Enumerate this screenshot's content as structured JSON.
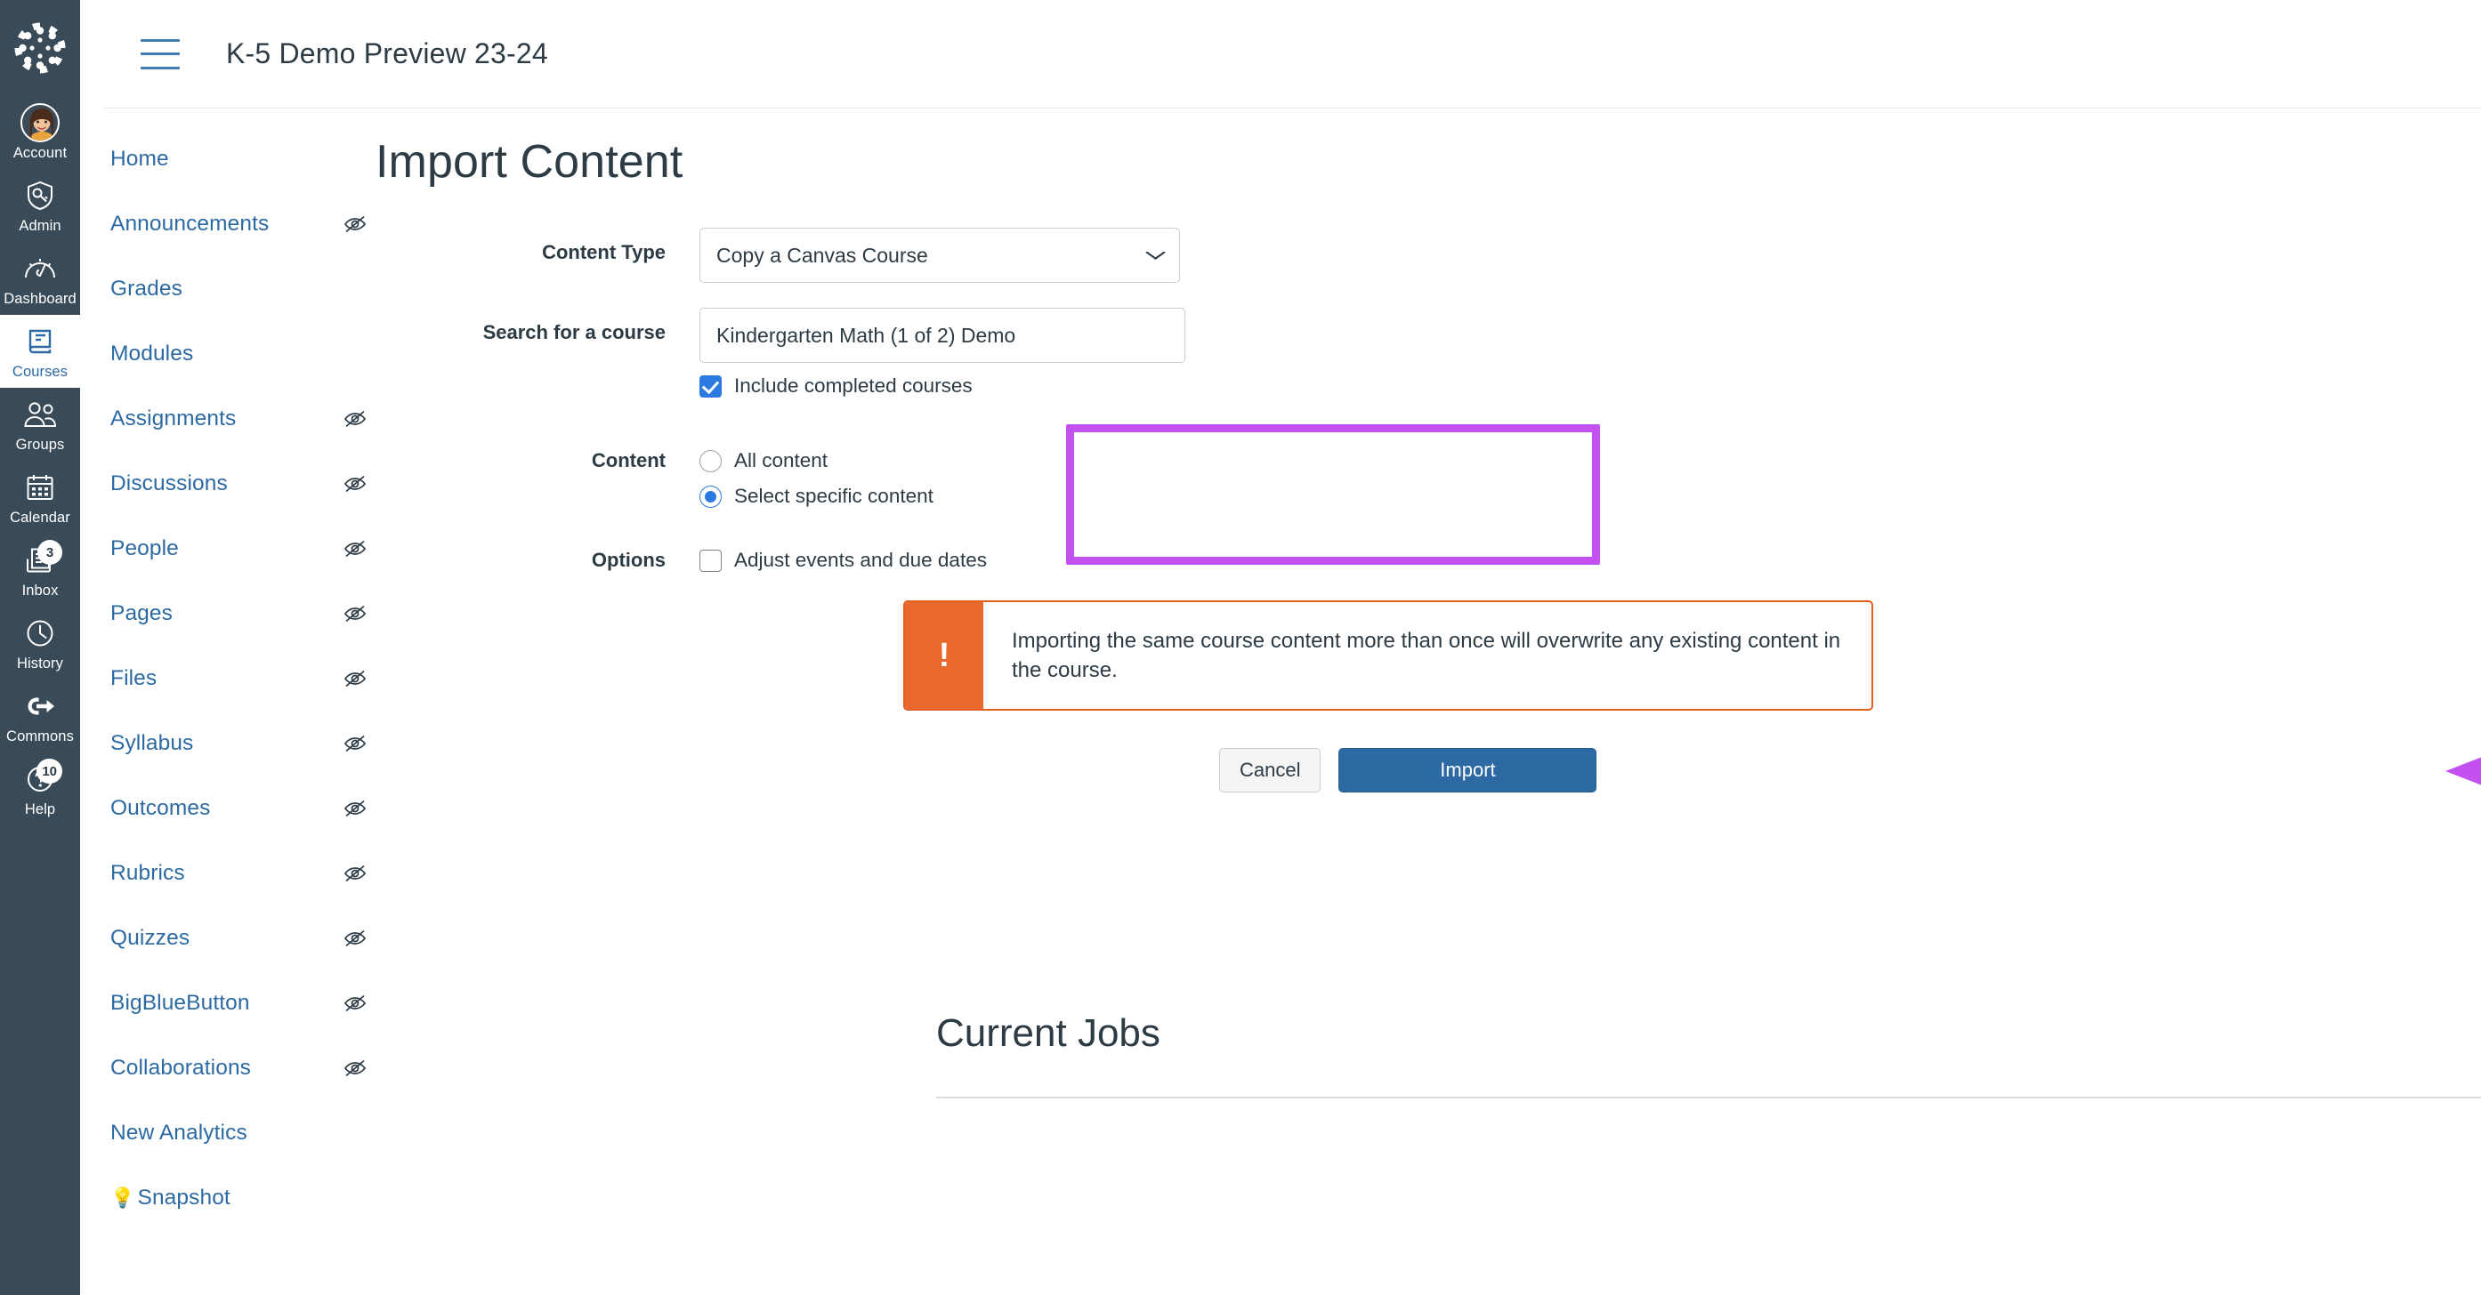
{
  "global_nav": {
    "logo_icon": "canvas-logo-icon",
    "items": [
      {
        "label": "Account",
        "icon": "avatar-icon",
        "badge": null,
        "active": false
      },
      {
        "label": "Admin",
        "icon": "shield-key-icon",
        "badge": null,
        "active": false
      },
      {
        "label": "Dashboard",
        "icon": "gauge-icon",
        "badge": null,
        "active": false
      },
      {
        "label": "Courses",
        "icon": "book-icon",
        "badge": null,
        "active": true
      },
      {
        "label": "Groups",
        "icon": "people-icon",
        "badge": null,
        "active": false
      },
      {
        "label": "Calendar",
        "icon": "calendar-icon",
        "badge": null,
        "active": false
      },
      {
        "label": "Inbox",
        "icon": "inbox-icon",
        "badge": "3",
        "active": false
      },
      {
        "label": "History",
        "icon": "clock-icon",
        "badge": null,
        "active": false
      },
      {
        "label": "Commons",
        "icon": "commons-icon",
        "badge": null,
        "active": false
      },
      {
        "label": "Help",
        "icon": "question-icon",
        "badge": "10",
        "active": false
      }
    ]
  },
  "header": {
    "menu_icon": "hamburger-icon",
    "course_title": "K-5 Demo Preview 23-24"
  },
  "course_nav": {
    "items": [
      {
        "label": "Home",
        "hidden_icon": false
      },
      {
        "label": "Announcements",
        "hidden_icon": true
      },
      {
        "label": "Grades",
        "hidden_icon": false
      },
      {
        "label": "Modules",
        "hidden_icon": false
      },
      {
        "label": "Assignments",
        "hidden_icon": true
      },
      {
        "label": "Discussions",
        "hidden_icon": true
      },
      {
        "label": "People",
        "hidden_icon": true
      },
      {
        "label": "Pages",
        "hidden_icon": true
      },
      {
        "label": "Files",
        "hidden_icon": true
      },
      {
        "label": "Syllabus",
        "hidden_icon": true
      },
      {
        "label": "Outcomes",
        "hidden_icon": true
      },
      {
        "label": "Rubrics",
        "hidden_icon": true
      },
      {
        "label": "Quizzes",
        "hidden_icon": true
      },
      {
        "label": "BigBlueButton",
        "hidden_icon": true
      },
      {
        "label": "Collaborations",
        "hidden_icon": true
      },
      {
        "label": "New Analytics",
        "hidden_icon": false
      },
      {
        "label": "Snapshot",
        "hidden_icon": false,
        "emoji": "💡"
      }
    ],
    "hidden_icon_name": "eye-slash-icon"
  },
  "main": {
    "page_title": "Import Content",
    "content_type": {
      "label": "Content Type",
      "value": "Copy a Canvas Course",
      "chevron": "⌄"
    },
    "search_course": {
      "label": "Search for a course",
      "value": "Kindergarten Math (1 of 2) Demo",
      "placeholder": "Search for a course"
    },
    "include_completed": {
      "label": "Include completed courses",
      "checked": true
    },
    "content": {
      "label": "Content",
      "options": [
        {
          "label": "All content",
          "selected": false
        },
        {
          "label": "Select specific content",
          "selected": true
        }
      ],
      "highlight_color": "#C251F0"
    },
    "options": {
      "label": "Options",
      "items": [
        {
          "label": "Adjust events and due dates",
          "checked": false
        }
      ]
    },
    "warning": {
      "icon": "exclamation-icon",
      "icon_glyph": "!",
      "text": "Importing the same course content more than once will overwrite any existing content in the course.",
      "accent_color": "#E9692C"
    },
    "buttons": {
      "cancel": "Cancel",
      "import": "Import"
    },
    "annotation": {
      "arrow_icon": "pointer-arrow-icon",
      "color": "#C251F0"
    },
    "jobs": {
      "title": "Current Jobs"
    }
  }
}
